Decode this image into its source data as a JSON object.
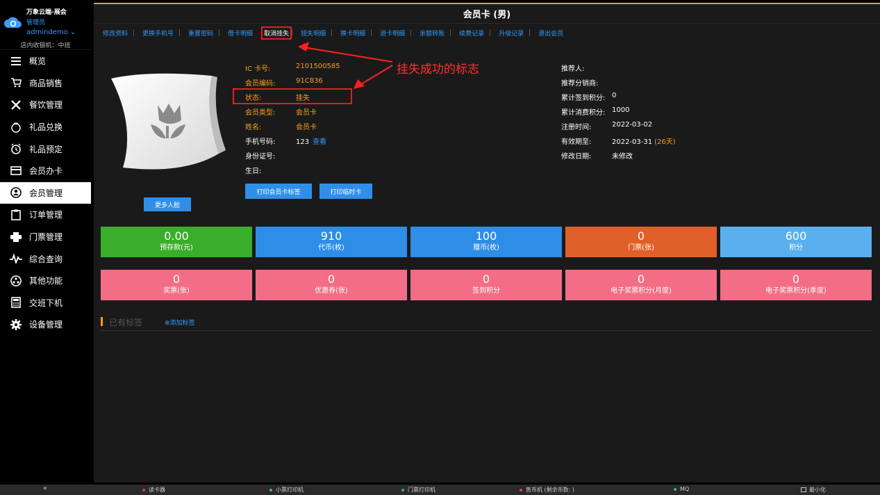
{
  "brand": {
    "app_name": "万象云端-展会",
    "role": "管理员",
    "user": "admindemo ⌄",
    "shift": "店内收银机：中班"
  },
  "sidebar": {
    "items": [
      {
        "label": "概览",
        "icon": "menu-lines-icon"
      },
      {
        "label": "商品销售",
        "icon": "cart-icon"
      },
      {
        "label": "餐饮管理",
        "icon": "utensils-icon"
      },
      {
        "label": "礼品兑换",
        "icon": "gift-icon"
      },
      {
        "label": "礼品预定",
        "icon": "clock-icon"
      },
      {
        "label": "会员办卡",
        "icon": "card-icon"
      },
      {
        "label": "会员管理",
        "icon": "user-icon"
      },
      {
        "label": "订单管理",
        "icon": "clipboard-icon"
      },
      {
        "label": "门票管理",
        "icon": "printer-icon"
      },
      {
        "label": "综合查询",
        "icon": "pulse-icon"
      },
      {
        "label": "其他功能",
        "icon": "more-circle-icon"
      },
      {
        "label": "交班下机",
        "icon": "calculator-icon"
      },
      {
        "label": "设备管理",
        "icon": "gear-icon"
      }
    ],
    "active": "会员管理"
  },
  "header": {
    "title": "会员卡 (男)"
  },
  "tabs": [
    "修改资料",
    "更换手机号",
    "重置密码",
    "借卡明细",
    "取消挂失",
    "挂失明细",
    "换卡明细",
    "退卡明细",
    "余额转账",
    "续费记录",
    "升级记录",
    "退出会员"
  ],
  "highlight_tab": "取消挂失",
  "member": {
    "left": [
      {
        "label": "IC 卡号:",
        "value": "2101500585",
        "color": "orange"
      },
      {
        "label": "会员编码:",
        "value": "91C836",
        "color": "orange"
      },
      {
        "label": "状态:",
        "value": "挂失",
        "color": "orange"
      },
      {
        "label": "会员类型:",
        "value": "会员卡",
        "color": "orange"
      },
      {
        "label": "姓名:",
        "value": "会员卡",
        "color": "orange"
      },
      {
        "label": "手机号码:",
        "value": "123",
        "link": "查看",
        "color": "white"
      },
      {
        "label": "身份证号:",
        "value": "",
        "color": "white"
      },
      {
        "label": "生日:",
        "value": "",
        "color": "white"
      }
    ],
    "right": [
      {
        "label": "推荐人:",
        "value": ""
      },
      {
        "label": "推荐分销商:",
        "value": ""
      },
      {
        "label": "累计签到积分:",
        "value": "0"
      },
      {
        "label": "累计消费积分:",
        "value": "1000"
      },
      {
        "label": "注册时间:",
        "value": "2022-03-02"
      },
      {
        "label": "有效期至:",
        "value": "2022-03-31",
        "extra": "(26天)"
      },
      {
        "label": "修改日期:",
        "value": "未修改"
      }
    ]
  },
  "buttons": {
    "print_label": "打印会员卡标签",
    "print_temp": "打印临时卡",
    "more_faces": "更多人脸"
  },
  "annotation": "挂失成功的标志",
  "stats_row1": [
    {
      "value": "0.00",
      "label": "预存款(元)",
      "color": "#3aae2a"
    },
    {
      "value": "910",
      "label": "代币(枚)",
      "color": "#2e8de6"
    },
    {
      "value": "100",
      "label": "赠币(枚)",
      "color": "#2e8de6"
    },
    {
      "value": "0",
      "label": "门票(张)",
      "color": "#e0602a"
    },
    {
      "value": "600",
      "label": "积分",
      "color": "#5ab0ef"
    }
  ],
  "stats_row2": [
    {
      "value": "0",
      "label": "奖票(张)",
      "color": "#f26d85"
    },
    {
      "value": "0",
      "label": "优惠券(张)",
      "color": "#f26d85"
    },
    {
      "value": "0",
      "label": "签到积分",
      "color": "#f26d85"
    },
    {
      "value": "0",
      "label": "电子奖票积分(月度)",
      "color": "#f26d85"
    },
    {
      "value": "0",
      "label": "电子奖票积分(季度)",
      "color": "#f26d85"
    }
  ],
  "tags": {
    "title": "已有标签",
    "add": "⊕添加标签"
  },
  "statusbar": {
    "collapse": "«",
    "items": [
      {
        "label": "读卡器",
        "color": "#e04040"
      },
      {
        "label": "小票打印机",
        "color": "#3ac05a"
      },
      {
        "label": "门票打印机",
        "color": "#3ac05a"
      },
      {
        "label": "售币机 (剩余币数: )",
        "color": "#e04040"
      },
      {
        "label": "MQ",
        "color": "#3ac05a"
      }
    ],
    "minimize": "最小化"
  }
}
